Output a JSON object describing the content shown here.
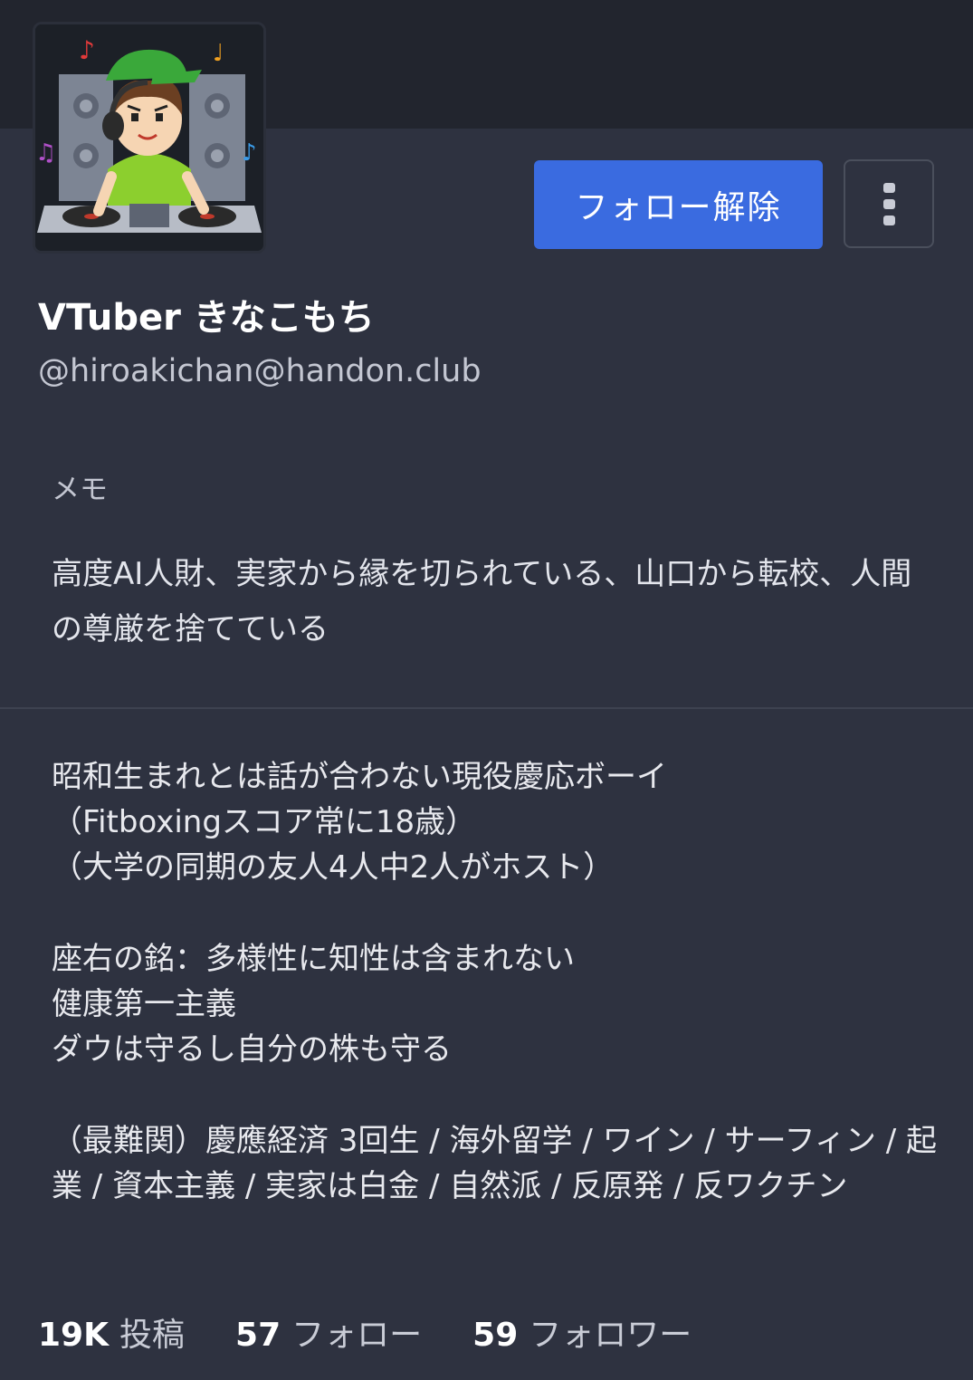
{
  "profile": {
    "display_name": "VTuber きなこもち",
    "handle": "@hiroakichan@handon.club",
    "avatar_icon": "dj-character-avatar"
  },
  "actions": {
    "unfollow_label": "フォロー解除",
    "more_icon": "more-vertical-icon"
  },
  "memo": {
    "label": "メモ",
    "text": "高度AI人財、実家から縁を切られている、山口から転校、人間の尊厳を捨てている"
  },
  "bio": {
    "line1": "昭和生まれとは話が合わない現役慶応ボーイ",
    "line2": "（Fitboxingスコア常に18歳）",
    "line3": "（大学の同期の友人4人中2人がホスト）",
    "line4": "座右の銘：多様性に知性は含まれない",
    "line5": "健康第一主義",
    "line6": "ダウは守るし自分の株も守る",
    "line7": "（最難関）慶應経済 3回生 / 海外留学 / ワイン / サーフィン / 起業 / 資本主義 / 実家は白金 / 自然派 / 反原発 / 反ワクチン"
  },
  "stats": {
    "posts_count": "19K",
    "posts_label": "投稿",
    "following_count": "57",
    "following_label": "フォロー",
    "followers_count": "59",
    "followers_label": "フォロワー"
  },
  "colors": {
    "background": "#2e3240",
    "banner": "#22252e",
    "accent": "#3a6be0"
  }
}
